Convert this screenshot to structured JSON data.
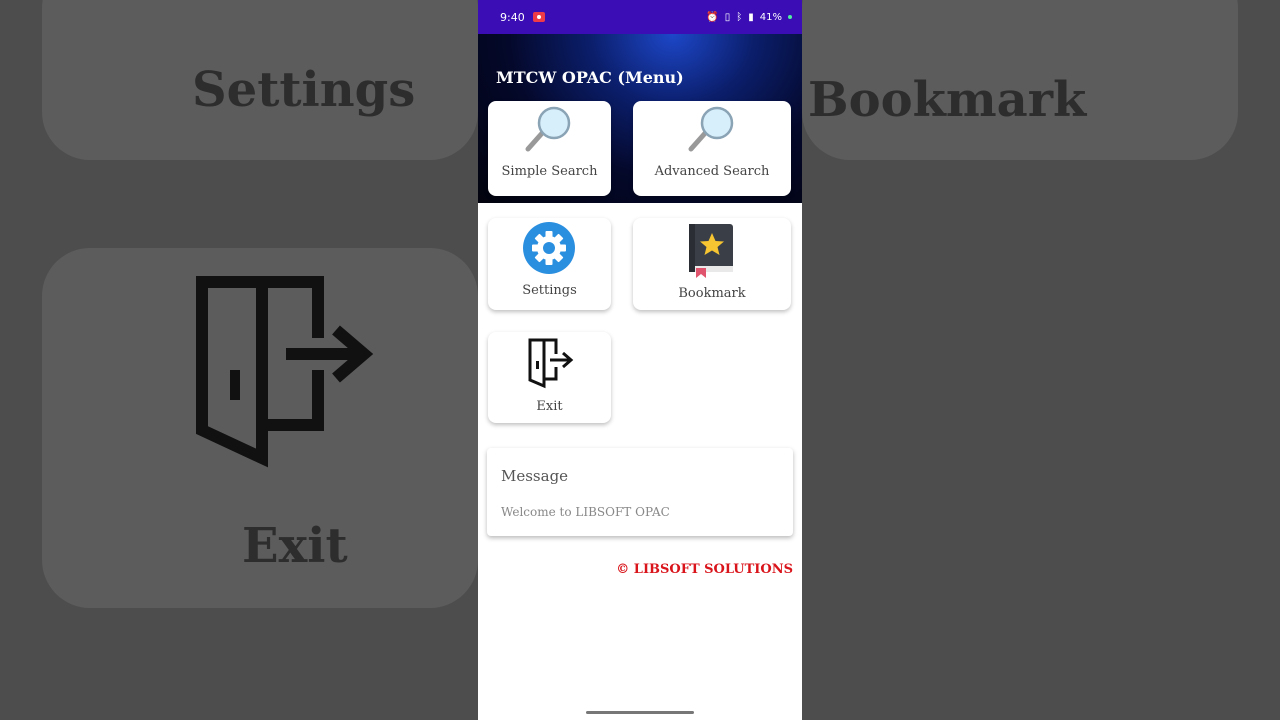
{
  "status_bar": {
    "time": "9:40",
    "battery": "41%"
  },
  "app": {
    "title": "MTCW OPAC (Menu)"
  },
  "menu": {
    "simple_search": "Simple Search",
    "advanced_search": "Advanced Search",
    "settings": "Settings",
    "bookmark": "Bookmark",
    "exit": "Exit"
  },
  "message": {
    "title": "Message",
    "text": "Welcome to LIBSOFT OPAC"
  },
  "footer": {
    "copyright": "© LIBSOFT SOLUTIONS"
  },
  "colors": {
    "status_bar": "#3a0db5",
    "footer_text": "#d9141b",
    "settings_icon": "#2b8fe0"
  }
}
